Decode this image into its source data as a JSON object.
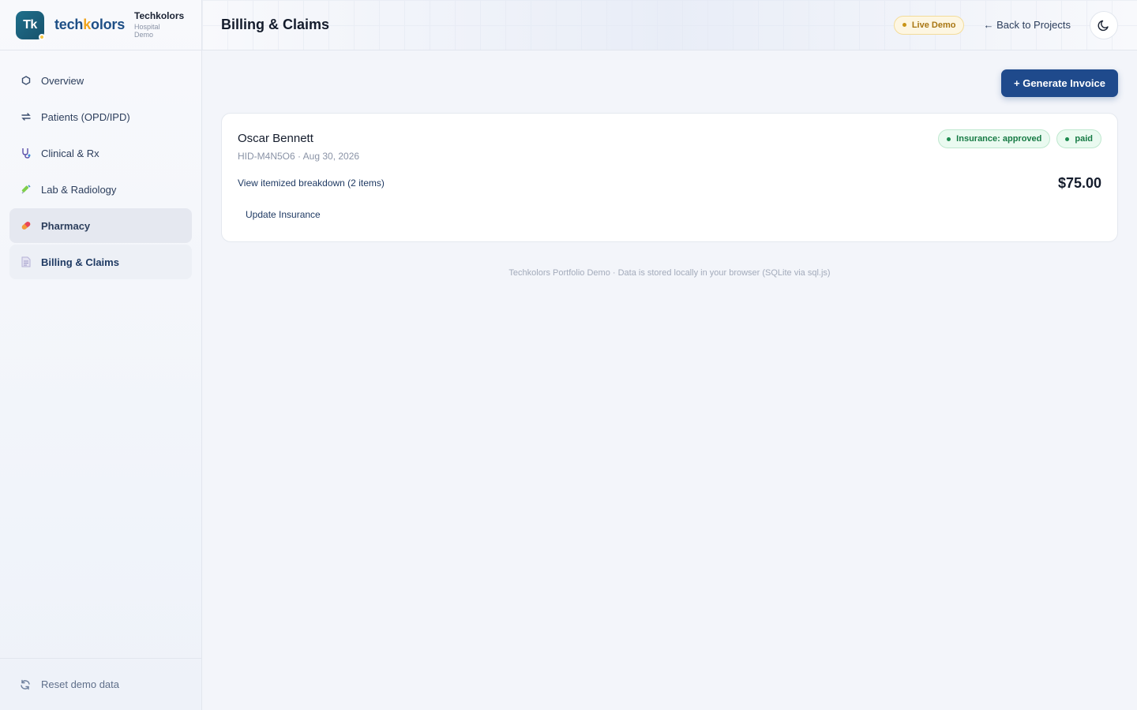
{
  "brand": {
    "logo_initials": "Tk",
    "word_part1": "tech",
    "word_k": "k",
    "word_part2": "olors",
    "name": "Techkolors",
    "sub_line1": "Hospital",
    "sub_line2": "Demo"
  },
  "sidebar": {
    "items": [
      {
        "label": "Overview",
        "icon": "hexagon-icon"
      },
      {
        "label": "Patients (OPD/IPD)",
        "icon": "arrows-exchange-icon"
      },
      {
        "label": "Clinical & Rx",
        "icon": "stethoscope-icon"
      },
      {
        "label": "Lab & Radiology",
        "icon": "syringe-icon"
      },
      {
        "label": "Pharmacy",
        "icon": "pill-icon"
      },
      {
        "label": "Billing & Claims",
        "icon": "document-icon"
      }
    ],
    "footer_label": "Reset demo data"
  },
  "header": {
    "title": "Billing & Claims",
    "live_badge": "Live Demo",
    "back_link": "← Back to Projects",
    "theme_icon": "moon-icon"
  },
  "main": {
    "generate_button": "+ Generate Invoice",
    "invoice": {
      "patient_name": "Oscar Bennett",
      "meta": "HID-M4N5O6 · Aug 30, 2026",
      "insurance_chip": "Insurance: approved",
      "status_chip": "paid",
      "breakdown_link": "View itemized breakdown (2 items)",
      "amount": "$75.00",
      "update_insurance": "Update Insurance"
    },
    "footer_note": "Techkolors Portfolio Demo · Data is stored locally in your browser (SQLite via sql.js)"
  },
  "colors": {
    "primary": "#1f4a8c",
    "success": "#167a44",
    "warning": "#a87612",
    "logo": "#1f6f8b"
  }
}
